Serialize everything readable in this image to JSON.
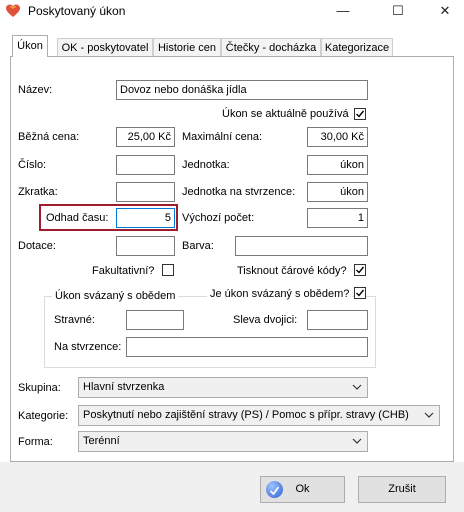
{
  "window": {
    "title": "Poskytovaný úkon",
    "minimize": "—",
    "maximize": "☐",
    "close": "✕"
  },
  "tabs": [
    {
      "label": "Úkon"
    },
    {
      "label": "OK - poskytovatel"
    },
    {
      "label": "Historie cen"
    },
    {
      "label": "Čtečky - docházka"
    },
    {
      "label": "Kategorizace"
    }
  ],
  "form": {
    "nazev": {
      "label": "Název:",
      "value": "Dovoz nebo donáška jídla"
    },
    "aktualne": {
      "label": "Úkon se aktuálně používá",
      "checked": true
    },
    "bezna_cena": {
      "label": "Běžná cena:",
      "value": "25,00 Kč"
    },
    "max_cena": {
      "label": "Maximální cena:",
      "value": "30,00 Kč"
    },
    "cislo": {
      "label": "Číslo:",
      "value": ""
    },
    "jednotka": {
      "label": "Jednotka:",
      "value": "úkon"
    },
    "zkratka": {
      "label": "Zkratka:",
      "value": ""
    },
    "jednotka_stvrzenka": {
      "label": "Jednotka na stvrzence:",
      "value": "úkon"
    },
    "odhad_casu": {
      "label": "Odhad času:",
      "value": "5"
    },
    "vychozi_pocet": {
      "label": "Výchozí počet:",
      "value": "1"
    },
    "dotace": {
      "label": "Dotace:",
      "value": ""
    },
    "barva": {
      "label": "Barva:",
      "value": ""
    },
    "fakultativni": {
      "label": "Fakultativní?",
      "checked": false
    },
    "tisknout": {
      "label": "Tisknout čárové kódy?",
      "checked": true
    },
    "obed_group": {
      "title": "Úkon svázaný s obědem",
      "je_svazany": {
        "label": "Je úkon svázaný s obědem?",
        "checked": true
      },
      "stravne": {
        "label": "Stravné:",
        "value": ""
      },
      "sleva": {
        "label": "Sleva dvojici:",
        "value": ""
      },
      "na_stvrzence": {
        "label": "Na stvrzence:",
        "value": ""
      }
    },
    "skupina": {
      "label": "Skupina:",
      "value": "Hlavní stvrzenka"
    },
    "kategorie": {
      "label": "Kategorie:",
      "value": "Poskytnutí nebo zajištění stravy (PS) / Pomoc s přípr. stravy (CHB)"
    },
    "forma": {
      "label": "Forma:",
      "value": "Terénní"
    }
  },
  "buttons": {
    "ok": "Ok",
    "cancel": "Zrušit"
  },
  "colors": {
    "highlight": "#9e1c2b",
    "focus": "#0078d7"
  }
}
